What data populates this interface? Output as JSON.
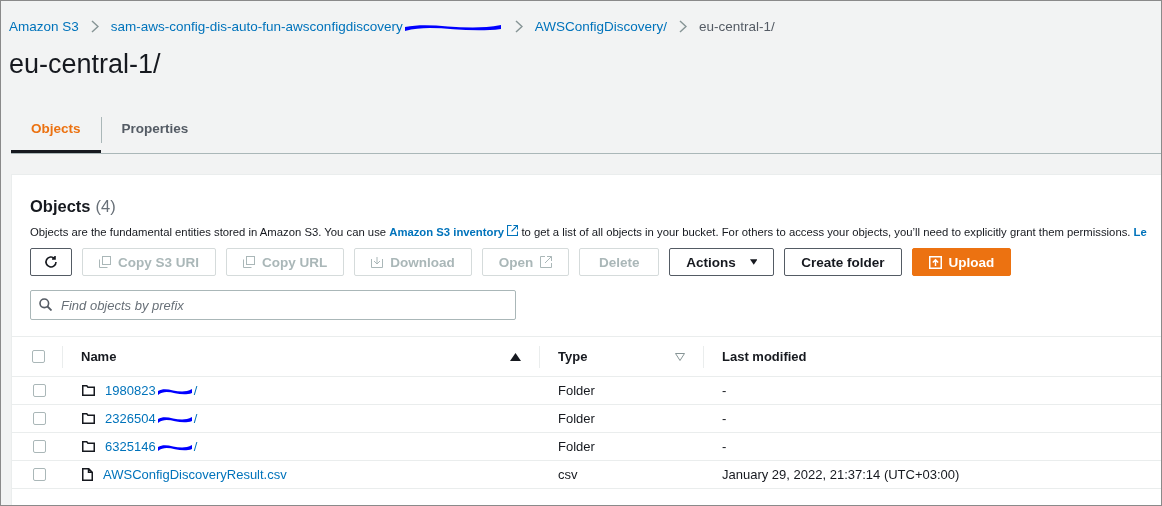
{
  "breadcrumbs": [
    {
      "label": "Amazon S3",
      "kind": "link",
      "redacted": false
    },
    {
      "label": "sam-aws-config-dis-auto-fun-awsconfigdiscovery",
      "kind": "link",
      "redacted": true
    },
    {
      "label": "AWSConfigDiscovery/",
      "kind": "link",
      "redacted": false
    },
    {
      "label": "eu-central-1/",
      "kind": "current",
      "redacted": false
    }
  ],
  "title": "eu-central-1/",
  "tabs": [
    {
      "label": "Objects",
      "selected": true
    },
    {
      "label": "Properties",
      "selected": false
    }
  ],
  "panel": {
    "heading": "Objects",
    "count": "(4)",
    "description": {
      "before": "Objects are the fundamental entities stored in Amazon S3. You can use",
      "link": "Amazon S3 inventory",
      "after": "to get a list of all objects in your bucket. For others to access your objects, you’ll need to explicitly grant them permissions.",
      "cut_link": "Le"
    },
    "buttons": [
      {
        "kind": "refresh",
        "disabled": false
      },
      {
        "kind": "copy",
        "label": "Copy S3 URI",
        "disabled": true
      },
      {
        "kind": "copy",
        "label": "Copy URL",
        "disabled": true
      },
      {
        "kind": "download",
        "label": "Download",
        "disabled": true
      },
      {
        "kind": "external",
        "label": "Open",
        "disabled": true
      },
      {
        "kind": "plain",
        "label": "Delete",
        "disabled": true
      },
      {
        "kind": "dropdown",
        "label": "Actions",
        "disabled": false
      },
      {
        "kind": "plain",
        "label": "Create folder",
        "disabled": false
      },
      {
        "kind": "primary",
        "label": "Upload",
        "disabled": false
      }
    ],
    "search": {
      "placeholder": "Find objects by prefix"
    }
  },
  "table": {
    "select_all_checked": false,
    "columns": [
      {
        "label": "Name",
        "sorted": true
      },
      {
        "label": "Type",
        "sorted": false
      },
      {
        "label": "Last modified"
      }
    ],
    "rows": [
      {
        "kind": "folder",
        "name": "1980823",
        "suffix": "/",
        "redacted": true,
        "checked": false,
        "type": "Folder",
        "modified": "-"
      },
      {
        "kind": "folder",
        "name": "2326504",
        "suffix": "/",
        "redacted": true,
        "checked": false,
        "type": "Folder",
        "modified": "-"
      },
      {
        "kind": "folder",
        "name": "6325146",
        "suffix": "/",
        "redacted": true,
        "checked": false,
        "type": "Folder",
        "modified": "-"
      },
      {
        "kind": "file",
        "name": "AWSConfigDiscoveryResult.csv",
        "suffix": "",
        "redacted": false,
        "checked": false,
        "type": "csv",
        "modified": "January 29, 2022, 21:37:14 (UTC+03:00)"
      }
    ]
  }
}
